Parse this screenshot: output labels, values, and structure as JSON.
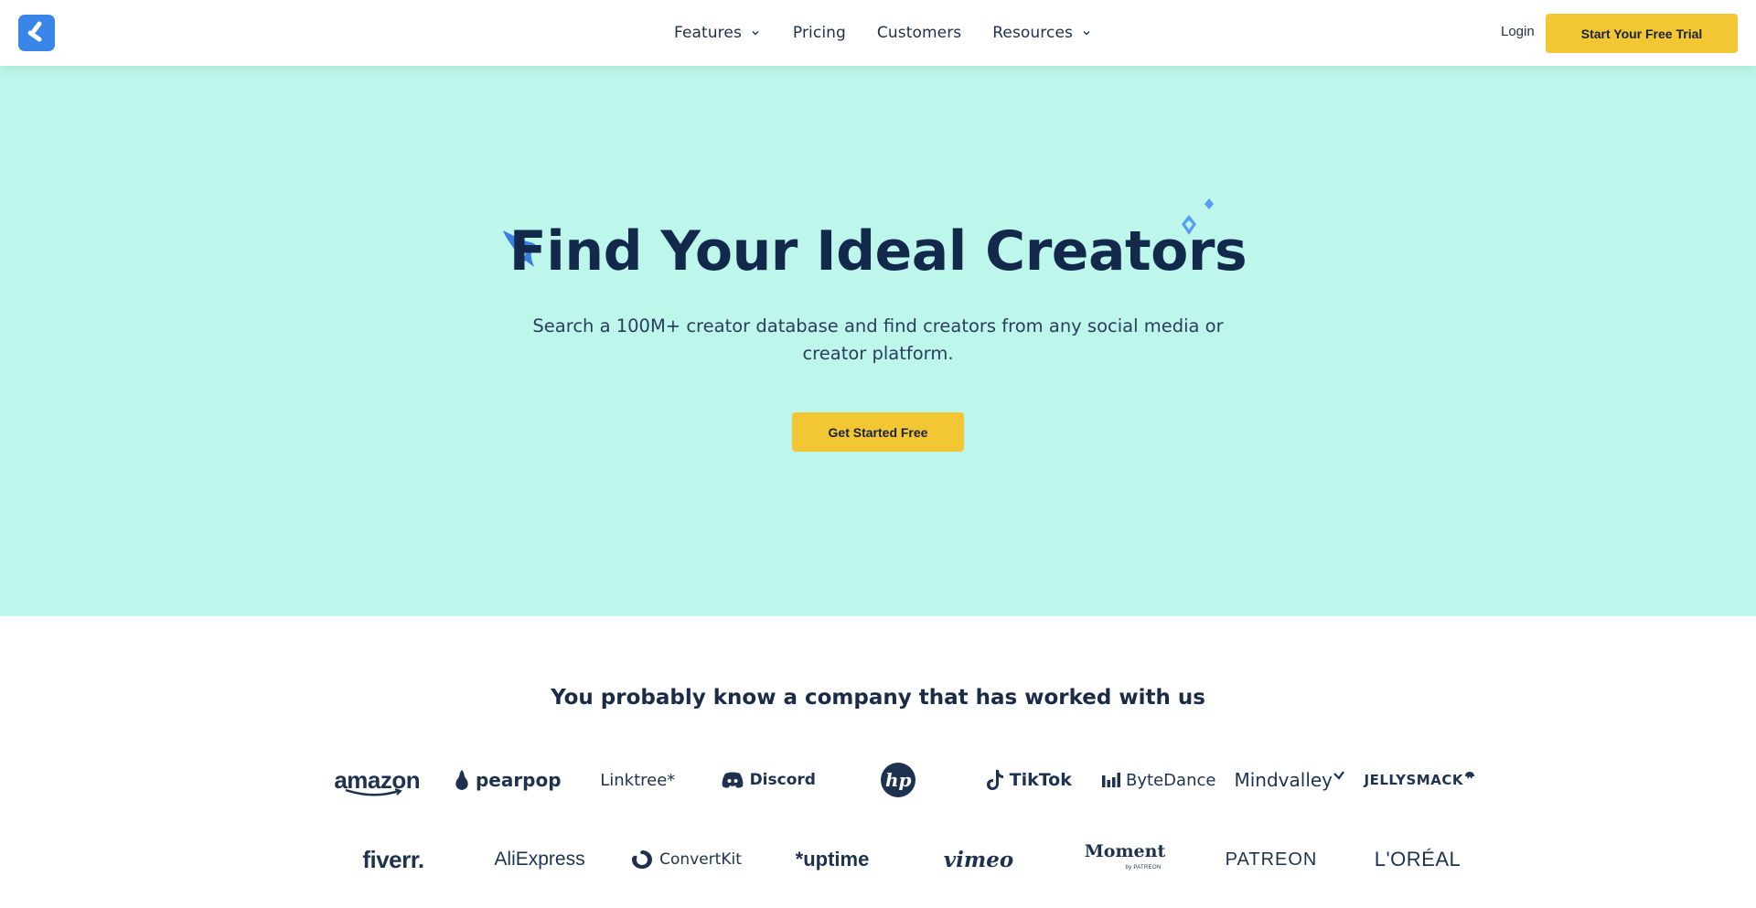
{
  "header": {
    "nav": [
      {
        "label": "Features",
        "has_dropdown": true
      },
      {
        "label": "Pricing",
        "has_dropdown": false
      },
      {
        "label": "Customers",
        "has_dropdown": false
      },
      {
        "label": "Resources",
        "has_dropdown": true
      }
    ],
    "login_label": "Login",
    "trial_label": "Start Your Free Trial"
  },
  "hero": {
    "title": "Find Your Ideal Creators",
    "subtitle": "Search a 100M+ creator database and find creators from any social media or creator platform.",
    "cta_label": "Get Started Free"
  },
  "logos": {
    "title": "You probably know a company that has worked with us",
    "row1": [
      "amazon",
      "pearpop",
      "Linktree*",
      "Discord",
      "hp",
      "TikTok",
      "ByteDance",
      "Mindvalley",
      "JELLYSMACK"
    ],
    "row2": [
      "fiverr.",
      "AliExpress",
      "ConvertKit",
      "*uptime",
      "vimeo",
      "Moment",
      "by PATREON",
      "PATREON",
      "L'ORÉAL"
    ]
  },
  "colors": {
    "hero_bg": "#bdf7ec",
    "accent_yellow": "#f2c733",
    "brand_blue": "#3a86e8",
    "text_navy": "#13294b"
  }
}
